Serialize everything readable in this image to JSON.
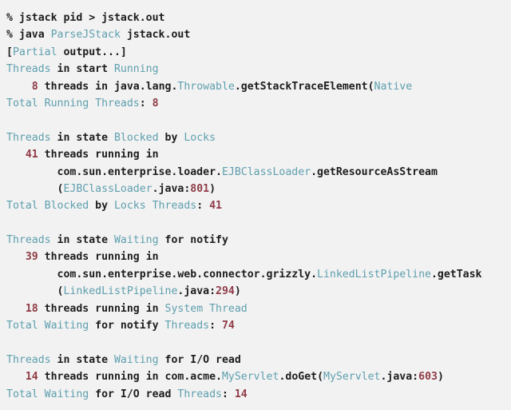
{
  "terminal": {
    "background_color": "#f2f2f2",
    "text_color": "#1d1d1d",
    "accent_teal": "#5e9fae",
    "accent_number": "#8e3b46",
    "lines": [
      {
        "id": "cmd-jstack",
        "tokens": [
          {
            "t": "% jstack pid > jstack.out",
            "c": "plain"
          }
        ]
      },
      {
        "id": "cmd-java",
        "tokens": [
          {
            "t": "% java ",
            "c": "plain"
          },
          {
            "t": "ParseJStack",
            "c": "teal"
          },
          {
            "t": " jstack.out",
            "c": "plain"
          }
        ]
      },
      {
        "id": "partial-output",
        "tokens": [
          {
            "t": "[",
            "c": "plain"
          },
          {
            "t": "Partial",
            "c": "teal"
          },
          {
            "t": " output...]",
            "c": "plain"
          }
        ]
      },
      {
        "id": "hdr-running",
        "tokens": [
          {
            "t": "Threads",
            "c": "teal"
          },
          {
            "t": " in start ",
            "c": "plain"
          },
          {
            "t": "Running",
            "c": "teal"
          }
        ]
      },
      {
        "id": "running-detail",
        "tokens": [
          {
            "t": "    ",
            "c": "plain"
          },
          {
            "t": "8",
            "c": "num"
          },
          {
            "t": " threads in java.lang.",
            "c": "plain"
          },
          {
            "t": "Throwable",
            "c": "teal"
          },
          {
            "t": ".getStackTraceElement(",
            "c": "plain"
          },
          {
            "t": "Native",
            "c": "teal"
          }
        ]
      },
      {
        "id": "total-running",
        "tokens": [
          {
            "t": "Total Running Threads",
            "c": "teal"
          },
          {
            "t": ": ",
            "c": "plain"
          },
          {
            "t": "8",
            "c": "num"
          }
        ]
      },
      {
        "id": "blank-1",
        "tokens": []
      },
      {
        "id": "hdr-blocked",
        "tokens": [
          {
            "t": "Threads",
            "c": "teal"
          },
          {
            "t": " in state ",
            "c": "plain"
          },
          {
            "t": "Blocked",
            "c": "teal"
          },
          {
            "t": " by ",
            "c": "plain"
          },
          {
            "t": "Locks",
            "c": "teal"
          }
        ]
      },
      {
        "id": "blocked-count",
        "tokens": [
          {
            "t": "   ",
            "c": "plain"
          },
          {
            "t": "41",
            "c": "num"
          },
          {
            "t": " threads running in",
            "c": "plain"
          }
        ]
      },
      {
        "id": "blocked-class",
        "tokens": [
          {
            "t": "        com.sun.enterprise.loader.",
            "c": "plain"
          },
          {
            "t": "EJBClassLoader",
            "c": "teal"
          },
          {
            "t": ".getResourceAsStream",
            "c": "plain"
          }
        ]
      },
      {
        "id": "blocked-source",
        "tokens": [
          {
            "t": "        (",
            "c": "plain"
          },
          {
            "t": "EJBClassLoader",
            "c": "teal"
          },
          {
            "t": ".java:",
            "c": "plain"
          },
          {
            "t": "801",
            "c": "num"
          },
          {
            "t": ")",
            "c": "plain"
          }
        ]
      },
      {
        "id": "total-blocked",
        "tokens": [
          {
            "t": "Total Blocked",
            "c": "teal"
          },
          {
            "t": " by ",
            "c": "plain"
          },
          {
            "t": "Locks Threads",
            "c": "teal"
          },
          {
            "t": ": ",
            "c": "plain"
          },
          {
            "t": "41",
            "c": "num"
          }
        ]
      },
      {
        "id": "blank-2",
        "tokens": []
      },
      {
        "id": "hdr-waiting-notify",
        "tokens": [
          {
            "t": "Threads",
            "c": "teal"
          },
          {
            "t": " in state ",
            "c": "plain"
          },
          {
            "t": "Waiting",
            "c": "teal"
          },
          {
            "t": " for notify",
            "c": "plain"
          }
        ]
      },
      {
        "id": "notify-count",
        "tokens": [
          {
            "t": "   ",
            "c": "plain"
          },
          {
            "t": "39",
            "c": "num"
          },
          {
            "t": " threads running in",
            "c": "plain"
          }
        ]
      },
      {
        "id": "notify-class",
        "tokens": [
          {
            "t": "        com.sun.enterprise.web.connector.grizzly.",
            "c": "plain"
          },
          {
            "t": "LinkedListPipeline",
            "c": "teal"
          },
          {
            "t": ".getTask",
            "c": "plain"
          }
        ]
      },
      {
        "id": "notify-source",
        "tokens": [
          {
            "t": "        (",
            "c": "plain"
          },
          {
            "t": "LinkedListPipeline",
            "c": "teal"
          },
          {
            "t": ".java:",
            "c": "plain"
          },
          {
            "t": "294",
            "c": "num"
          },
          {
            "t": ")",
            "c": "plain"
          }
        ]
      },
      {
        "id": "notify-system",
        "tokens": [
          {
            "t": "   ",
            "c": "plain"
          },
          {
            "t": "18",
            "c": "num"
          },
          {
            "t": " threads running in ",
            "c": "plain"
          },
          {
            "t": "System Thread",
            "c": "teal"
          }
        ]
      },
      {
        "id": "total-notify",
        "tokens": [
          {
            "t": "Total Waiting",
            "c": "teal"
          },
          {
            "t": " for notify ",
            "c": "plain"
          },
          {
            "t": "Threads",
            "c": "teal"
          },
          {
            "t": ": ",
            "c": "plain"
          },
          {
            "t": "74",
            "c": "num"
          }
        ]
      },
      {
        "id": "blank-3",
        "tokens": []
      },
      {
        "id": "hdr-waiting-io",
        "tokens": [
          {
            "t": "Threads",
            "c": "teal"
          },
          {
            "t": " in state ",
            "c": "plain"
          },
          {
            "t": "Waiting",
            "c": "teal"
          },
          {
            "t": " for I/O read",
            "c": "plain"
          }
        ]
      },
      {
        "id": "io-detail",
        "tokens": [
          {
            "t": "   ",
            "c": "plain"
          },
          {
            "t": "14",
            "c": "num"
          },
          {
            "t": " threads running in com.acme.",
            "c": "plain"
          },
          {
            "t": "MyServlet",
            "c": "teal"
          },
          {
            "t": ".doGet(",
            "c": "plain"
          },
          {
            "t": "MyServlet",
            "c": "teal"
          },
          {
            "t": ".java:",
            "c": "plain"
          },
          {
            "t": "603",
            "c": "num"
          },
          {
            "t": ")",
            "c": "plain"
          }
        ]
      },
      {
        "id": "total-io",
        "tokens": [
          {
            "t": "Total Waiting",
            "c": "teal"
          },
          {
            "t": " for I/O read ",
            "c": "plain"
          },
          {
            "t": "Threads",
            "c": "teal"
          },
          {
            "t": ": ",
            "c": "plain"
          },
          {
            "t": "14",
            "c": "num"
          }
        ]
      }
    ]
  }
}
